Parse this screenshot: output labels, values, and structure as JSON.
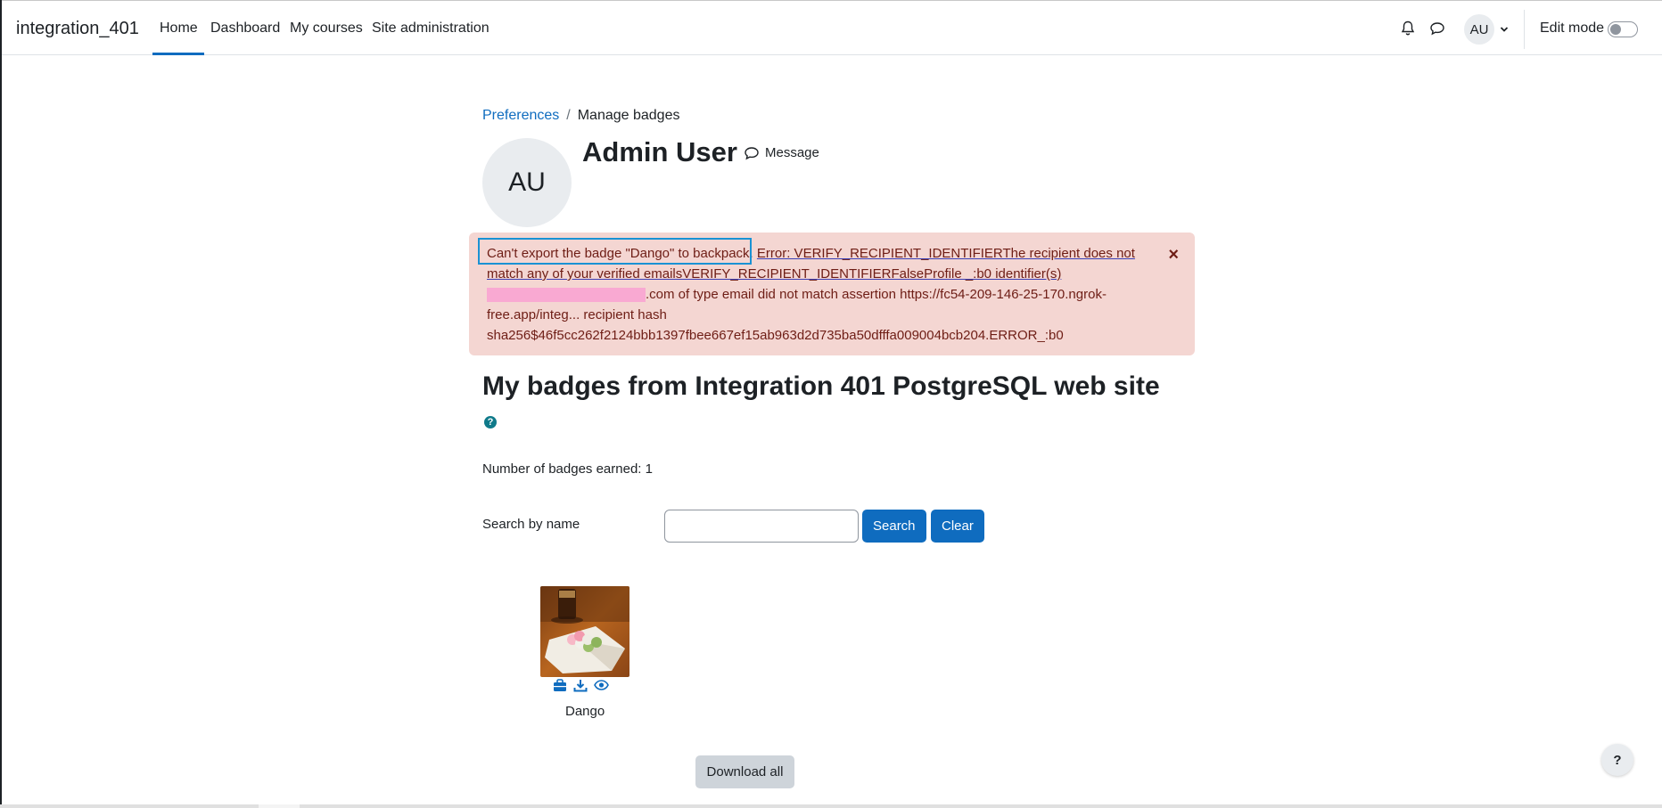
{
  "navbar": {
    "brand": "integration_401",
    "items": [
      {
        "label": "Home",
        "active": true
      },
      {
        "label": "Dashboard"
      },
      {
        "label": "My courses"
      },
      {
        "label": "Site administration"
      }
    ],
    "user_initials": "AU",
    "edit_mode_label": "Edit mode",
    "edit_mode_on": false
  },
  "breadcrumb": {
    "items": [
      {
        "label": "Preferences"
      },
      {
        "label": "Manage badges"
      }
    ],
    "separator": "/"
  },
  "profile": {
    "initials": "AU",
    "name": "Admin User",
    "message_label": "Message"
  },
  "alert": {
    "lead": "Can't export the badge \"Dango\" to backpack.",
    "error_part": "Error: VERIFY_RECIPIENT_IDENTIFIERThe recipient does not match any of your verified emailsVERIFY_RECIPIENT_IDENTIFIERFalseProfile _:b0 identifier(s)",
    "after_redacted": ".com of type email did not match assertion https://fc54-209-146-25-170.ngrok-free.app/integ... recipient hash sha256$46f5cc262f2124bbb1397fbee667ef15ab963d2d735ba50dfffa009004bcb204.ERROR_:b0",
    "close": "×",
    "color_bg": "#f4d6d2",
    "color_text": "#6e1d15"
  },
  "section": {
    "title": "My badges from Integration 401 PostgreSQL web site",
    "help": "?",
    "earned": "Number of badges earned: 1"
  },
  "search": {
    "label": "Search by name",
    "value": "",
    "search_button": "Search",
    "clear_button": "Clear"
  },
  "badges": [
    {
      "name": "Dango",
      "actions": [
        "backpack-icon",
        "download-icon",
        "eye-icon"
      ]
    }
  ],
  "download_all": "Download all",
  "help_fab": "?",
  "colors": {
    "primary": "#0f6cbf",
    "secondary": "#ced4da"
  }
}
